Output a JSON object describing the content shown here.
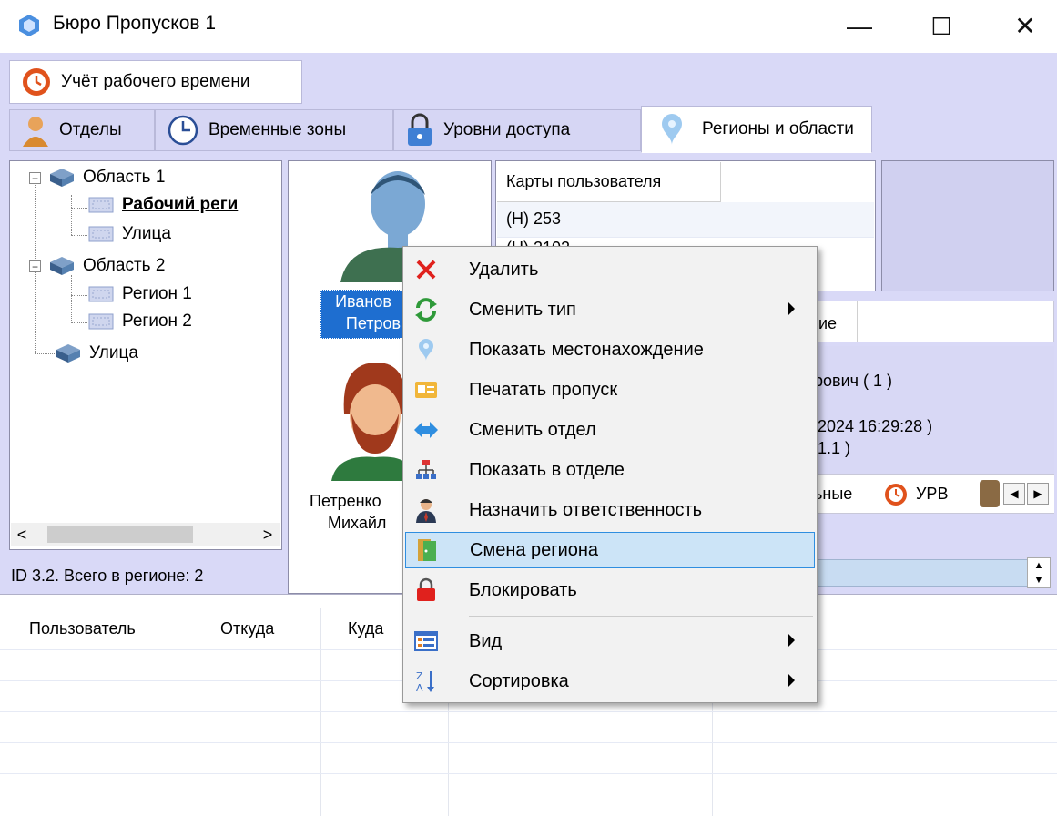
{
  "window": {
    "title": "Бюро Пропусков 1",
    "minimize": "—",
    "maximize": "☐",
    "close": "✕"
  },
  "top_tab": {
    "label": "Учёт рабочего времени"
  },
  "tabs": [
    {
      "label": "Отделы"
    },
    {
      "label": "Временные зоны"
    },
    {
      "label": "Уровни доступа"
    },
    {
      "label": "Регионы и области"
    }
  ],
  "tree": {
    "items": [
      {
        "label": "Область 1"
      },
      {
        "label": "Рабочий реги"
      },
      {
        "label": "Улица"
      },
      {
        "label": "Область 2"
      },
      {
        "label": "Регион 1"
      },
      {
        "label": "Регион 2"
      },
      {
        "label": "Улица"
      }
    ],
    "status": "ID 3.2. Всего в регионе: 2"
  },
  "users": [
    {
      "line1": "Иванов",
      "line2": "Петров"
    },
    {
      "line1": "Петренко",
      "line2": "Михайл"
    }
  ],
  "cards": {
    "header": "Карты пользователя",
    "rows": [
      "(H) 253",
      "(H) 2102"
    ]
  },
  "details": {
    "col_header": "ие",
    "lines": [
      "рович ( 1 )",
      ")",
      "2024 16:29:28 )",
      "1.1 )"
    ],
    "subtabs": [
      "ьные",
      "УРВ"
    ]
  },
  "grid": {
    "columns": [
      "Пользователь",
      "Откуда",
      "Куда"
    ]
  },
  "context_menu": {
    "items": [
      {
        "label": "Удалить",
        "icon": "delete-x-icon",
        "submenu": false
      },
      {
        "label": "Сменить тип",
        "icon": "refresh-arrows-icon",
        "submenu": true
      },
      {
        "label": "Показать местонахождение",
        "icon": "location-pin-icon",
        "submenu": false
      },
      {
        "label": "Печатать пропуск",
        "icon": "print-pass-icon",
        "submenu": false
      },
      {
        "label": "Сменить отдел",
        "icon": "swap-arrows-icon",
        "submenu": false
      },
      {
        "label": "Показать в отделе",
        "icon": "org-chart-icon",
        "submenu": false
      },
      {
        "label": "Назначить ответственность",
        "icon": "responsible-person-icon",
        "submenu": false
      },
      {
        "label": "Смена региона",
        "icon": "region-door-icon",
        "submenu": false,
        "highlighted": true
      },
      {
        "label": "Блокировать",
        "icon": "lock-icon",
        "submenu": false
      },
      {
        "label": "Вид",
        "icon": "view-list-icon",
        "submenu": true
      },
      {
        "label": "Сортировка",
        "icon": "sort-az-icon",
        "submenu": true
      }
    ]
  },
  "colors": {
    "lavender": "#d9d9f7",
    "highlight": "#cce4f7",
    "highlight_border": "#2f8ee0",
    "selected_user": "#1e6ed0"
  }
}
